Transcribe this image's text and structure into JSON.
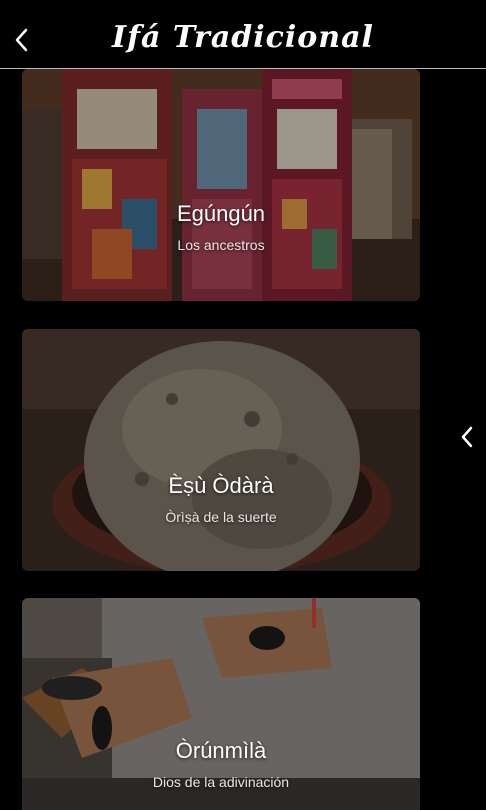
{
  "header": {
    "title": "Ifá Tradicional",
    "back_icon": "chevron-left-icon"
  },
  "cards": [
    {
      "name": "Egúngún",
      "subtitle": "Los ancestros"
    },
    {
      "name": "Èṣù Òdàrà",
      "subtitle": "Òrìṣà de la suerte"
    },
    {
      "name": "Òrúnmìlà",
      "subtitle": "Dios de la adivinación"
    }
  ],
  "side_nav": {
    "icon": "chevron-left-icon"
  },
  "colors": {
    "background": "#000000",
    "header_divider": "#bdbdbd",
    "text": "#ffffff"
  }
}
